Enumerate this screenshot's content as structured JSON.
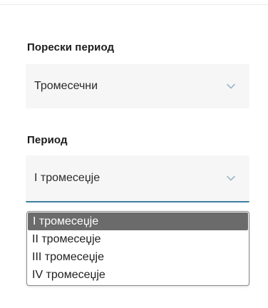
{
  "tax_period": {
    "label": "Порески период",
    "value": "Тромесечни",
    "chevron_icon": "chevron-down-icon"
  },
  "period": {
    "label": "Период",
    "value": "I тромесеџје",
    "chevron_icon": "chevron-down-icon",
    "options": [
      "I тромесеџје",
      "II тромесеџје",
      "III тромесеџје",
      "IV тромесеџје"
    ],
    "selected_index": 0
  },
  "colors": {
    "accent_underline": "#3f7f9e",
    "chevron": "#9bb8c8",
    "selected_option_bg": "#6b6b6b"
  }
}
